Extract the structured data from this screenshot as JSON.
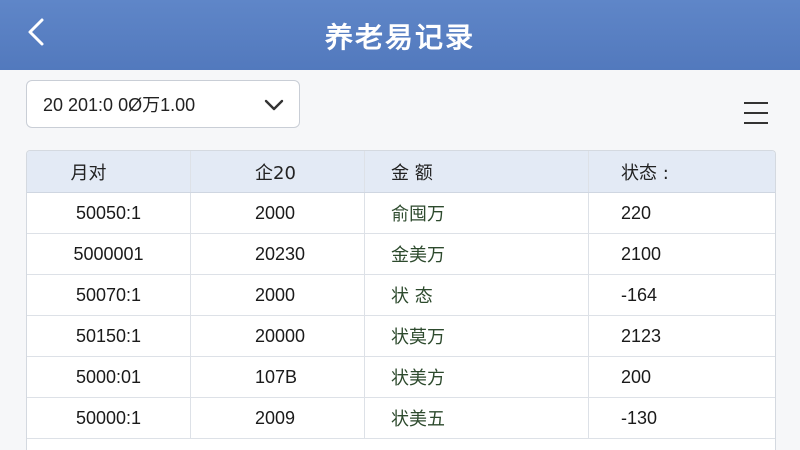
{
  "header": {
    "title": "养老易记录",
    "back_icon": "chevron-left-icon"
  },
  "filter": {
    "value": "20  201:0 0Ø万1.00",
    "icon": "chevron-down-icon"
  },
  "menu": {
    "icon": "hamburger-menu-icon"
  },
  "table": {
    "columns": [
      "月对",
      "企20",
      "金  额",
      "状态 :"
    ],
    "rows": [
      [
        "50050:1",
        "2000",
        "俞囤万",
        "220"
      ],
      [
        "5000001",
        "20230",
        "金美万",
        "2100"
      ],
      [
        "50070:1",
        "2000",
        "状  态",
        "-164"
      ],
      [
        "50150:1",
        "20000",
        "状莫万",
        "2123"
      ],
      [
        "5000:01",
        "107B",
        "状美方",
        "200"
      ],
      [
        "50000:1",
        "2009",
        "状美五",
        "-130"
      ]
    ]
  },
  "colors": {
    "header_bg": "#5279bd",
    "table_header_bg": "#e3eaf5"
  }
}
